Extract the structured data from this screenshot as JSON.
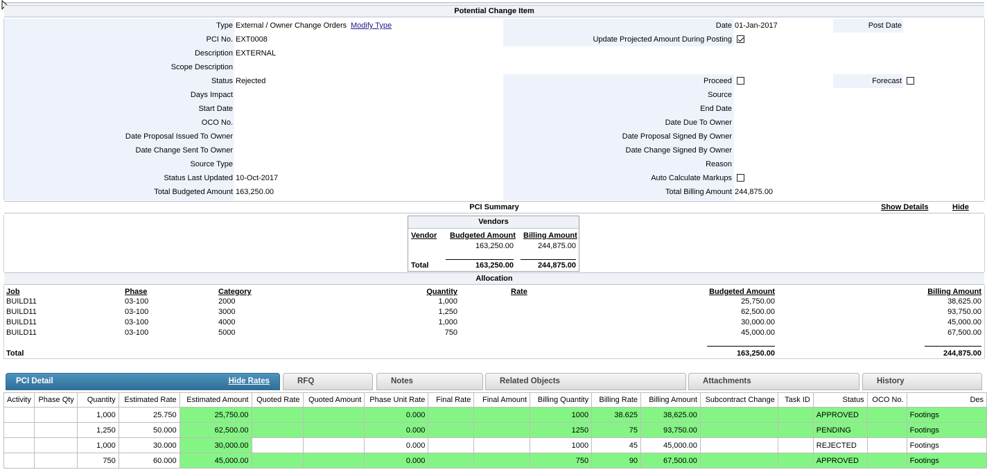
{
  "header": {
    "title": "Potential Change Item"
  },
  "left_fields": [
    {
      "label": "Type",
      "value": "External / Owner Change Orders"
    },
    {
      "label": "PCI No.",
      "value": "EXT0008"
    },
    {
      "label": "Description",
      "value": "EXTERNAL"
    },
    {
      "label": "Scope Description",
      "value": ""
    },
    {
      "label": "Status",
      "value": "Rejected"
    },
    {
      "label": "Days Impact",
      "value": ""
    },
    {
      "label": "Start Date",
      "value": ""
    },
    {
      "label": "OCO No.",
      "value": ""
    },
    {
      "label": "Date Proposal Issued To Owner",
      "value": ""
    },
    {
      "label": "Date Change Sent To Owner",
      "value": ""
    },
    {
      "label": "Source Type",
      "value": ""
    },
    {
      "label": "Status Last Updated",
      "value": "10-Oct-2017"
    },
    {
      "label": "Total Budgeted Amount",
      "value": "163,250.00"
    }
  ],
  "modify_type_link": "Modify Type",
  "right_fields": [
    {
      "label": "Date",
      "value": "01-Jan-2017"
    },
    {
      "label": "Update Projected Amount During Posting",
      "value": "",
      "checkbox": true,
      "checked": true
    },
    {
      "label": "",
      "value": ""
    },
    {
      "label": "",
      "value": ""
    },
    {
      "label": "Proceed",
      "value": "",
      "checkbox": true,
      "checked": false
    },
    {
      "label": "Source",
      "value": ""
    },
    {
      "label": "End Date",
      "value": ""
    },
    {
      "label": "Date Due To Owner",
      "value": ""
    },
    {
      "label": "Date Proposal Signed By Owner",
      "value": ""
    },
    {
      "label": "Date Change Signed By Owner",
      "value": ""
    },
    {
      "label": "Reason",
      "value": ""
    },
    {
      "label": "Auto Calculate Markups",
      "value": "",
      "checkbox": true,
      "checked": false
    },
    {
      "label": "Total Billing Amount",
      "value": "244,875.00"
    }
  ],
  "far_right": {
    "post_date_label": "Post Date",
    "forecast_label": "Forecast",
    "forecast_checked": false
  },
  "pci_summary": {
    "title": "PCI Summary",
    "show_details": "Show Details",
    "hide": "Hide",
    "vendors_title": "Vendors",
    "col_vendor": "Vendor",
    "col_budgeted": "Budgeted Amount",
    "col_billing": "Billing Amount",
    "row_budgeted": "163,250.00",
    "row_billing": "244,875.00",
    "total_label": "Total",
    "total_budgeted": "163,250.00",
    "total_billing": "244,875.00"
  },
  "allocation": {
    "title": "Allocation",
    "headers": {
      "job": "Job",
      "phase": "Phase",
      "category": "Category",
      "quantity": "Quantity",
      "rate": "Rate",
      "budgeted": "Budgeted Amount",
      "billing": "Billing Amount"
    },
    "rows": [
      {
        "job": "BUILD11",
        "phase": "03-100",
        "category": "2000",
        "quantity": "1,000",
        "rate": "",
        "budgeted": "25,750.00",
        "billing": "38,625.00"
      },
      {
        "job": "BUILD11",
        "phase": "03-100",
        "category": "3000",
        "quantity": "1,250",
        "rate": "",
        "budgeted": "62,500.00",
        "billing": "93,750.00"
      },
      {
        "job": "BUILD11",
        "phase": "03-100",
        "category": "4000",
        "quantity": "1,000",
        "rate": "",
        "budgeted": "30,000.00",
        "billing": "45,000.00"
      },
      {
        "job": "BUILD11",
        "phase": "03-100",
        "category": "5000",
        "quantity": "750",
        "rate": "",
        "budgeted": "45,000.00",
        "billing": "67,500.00"
      }
    ],
    "total_label": "Total",
    "total_budgeted": "163,250.00",
    "total_billing": "244,875.00"
  },
  "tabs": [
    {
      "label": "PCI Detail",
      "link": "Hide Rates",
      "active": true
    },
    {
      "label": "RFQ"
    },
    {
      "label": "Notes"
    },
    {
      "label": "Related Objects"
    },
    {
      "label": "Attachments"
    },
    {
      "label": "History"
    }
  ],
  "detail_grid": {
    "columns": [
      "Activity",
      "Phase Qty",
      "Quantity",
      "Estimated Rate",
      "Estimated Amount",
      "Quoted Rate",
      "Quoted Amount",
      "Phase Unit Rate",
      "Final Rate",
      "Final Amount",
      "Billing Quantity",
      "Billing Rate",
      "Billing Amount",
      "Subcontract Change",
      "Task ID",
      "Status",
      "OCO No.",
      "Des"
    ],
    "rows": [
      {
        "cells": [
          "",
          "",
          "1,000",
          "25.750",
          "25,750.00",
          "",
          "",
          "0.000",
          "",
          "",
          "1000",
          "38.625",
          "38,625.00",
          "",
          "",
          "APPROVED",
          "",
          "Footings"
        ],
        "highlight": true
      },
      {
        "cells": [
          "",
          "",
          "1,250",
          "50.000",
          "62,500.00",
          "",
          "",
          "0.000",
          "",
          "",
          "1250",
          "75",
          "93,750.00",
          "",
          "",
          "PENDING",
          "",
          "Footings"
        ],
        "highlight": true
      },
      {
        "cells": [
          "",
          "",
          "1,000",
          "30.000",
          "30,000.00",
          "",
          "",
          "0.000",
          "",
          "",
          "1000",
          "45",
          "45,000.00",
          "",
          "",
          "REJECTED",
          "",
          "Footings"
        ],
        "highlight": false
      },
      {
        "cells": [
          "",
          "",
          "750",
          "60.000",
          "45,000.00",
          "",
          "",
          "0.000",
          "",
          "",
          "750",
          "90",
          "67,500.00",
          "",
          "",
          "APPROVED",
          "",
          "Footings"
        ],
        "highlight": true
      }
    ]
  }
}
